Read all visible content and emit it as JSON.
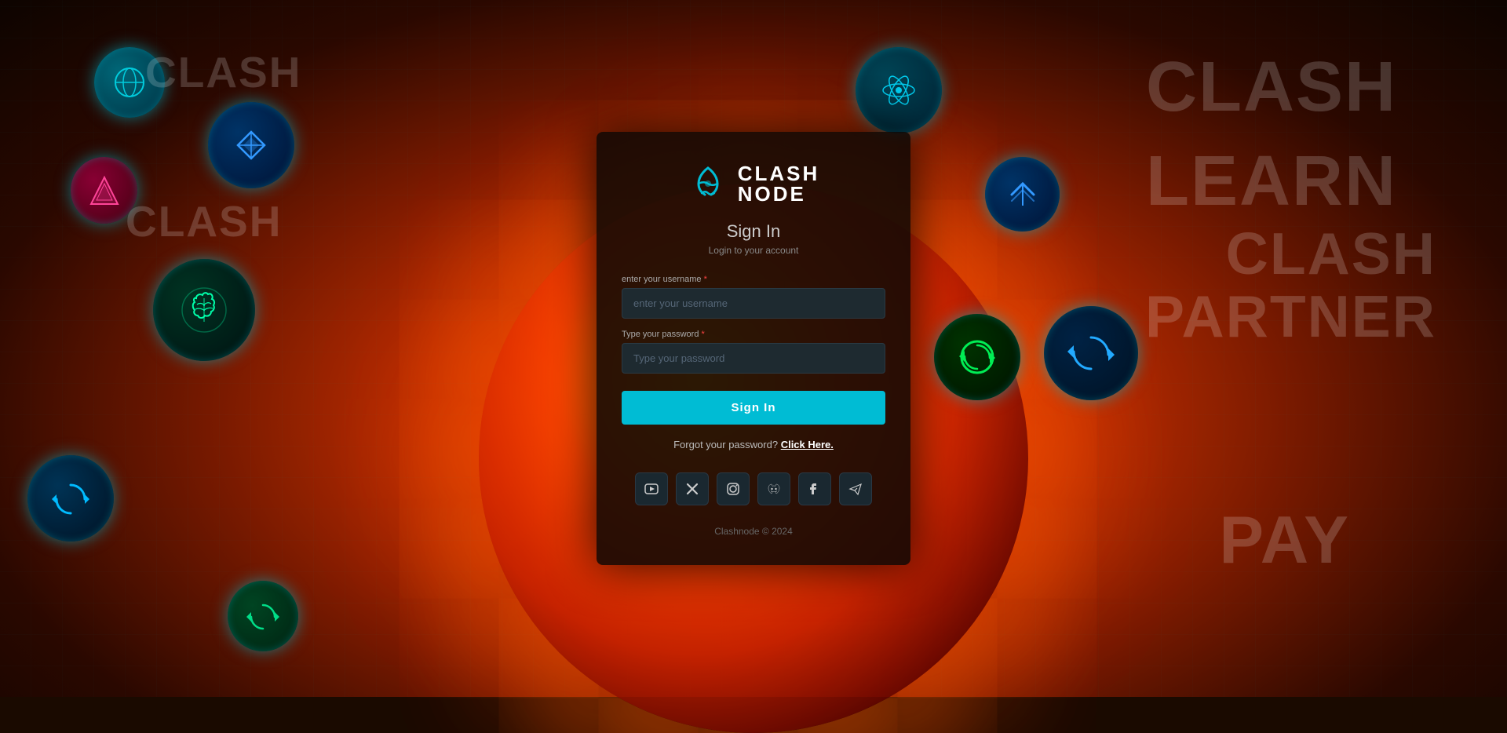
{
  "app": {
    "name": "Clashnode",
    "logo_clash": "CLASH",
    "logo_node": "NODE"
  },
  "background": {
    "bg_texts": [
      "CLASH",
      "CLASH",
      "CLASH",
      "LEARN",
      "CLASH",
      "PARTNER",
      "PAY"
    ]
  },
  "card": {
    "title": "Sign In",
    "subtitle": "Login to your account",
    "username_label": "enter your username",
    "username_required": "*",
    "username_placeholder": "enter your username",
    "password_label": "Type your password",
    "password_required": "*",
    "password_placeholder": "Type your password",
    "signin_button": "Sign In",
    "forgot_prefix": "Forgot your password?",
    "forgot_link": "Click Here.",
    "footer": "Clashnode © 2024"
  },
  "social": [
    {
      "name": "youtube",
      "icon": "▶",
      "label": "YouTube"
    },
    {
      "name": "twitter-x",
      "icon": "✕",
      "label": "X (Twitter)"
    },
    {
      "name": "instagram",
      "icon": "◉",
      "label": "Instagram"
    },
    {
      "name": "discord",
      "icon": "◈",
      "label": "Discord"
    },
    {
      "name": "facebook",
      "icon": "f",
      "label": "Facebook"
    },
    {
      "name": "telegram",
      "icon": "✈",
      "label": "Telegram"
    }
  ],
  "colors": {
    "accent": "#00bcd4",
    "card_bg": "rgba(15,8,5,0.88)",
    "input_bg": "#1e2a30"
  }
}
